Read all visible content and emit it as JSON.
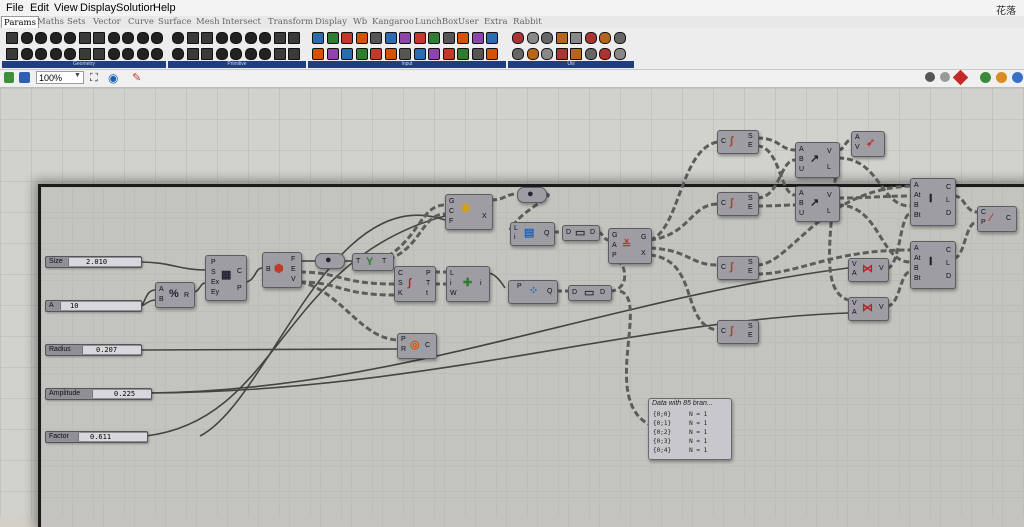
{
  "menu": [
    "File",
    "Edit",
    "View",
    "Display",
    "Solution",
    "Help"
  ],
  "app_corner": "花落",
  "tabs": [
    "Params",
    "Maths",
    "Sets",
    "Vector",
    "Curve",
    "Surface",
    "Mesh",
    "Intersect",
    "Transform",
    "Display",
    "Wb",
    "Kangaroo",
    "LunchBox",
    "User",
    "Extra",
    "Rabbit"
  ],
  "ribbon_panels": [
    "Geometry",
    "Primitive",
    "Input",
    "Util"
  ],
  "zoom": "100%",
  "sliders": {
    "size": {
      "label": "Size",
      "value": "2.010"
    },
    "a": {
      "label": "A",
      "value": "10"
    },
    "radius": {
      "label": "Radius",
      "value": "0.207"
    },
    "amplitude": {
      "label": "Amplitude",
      "value": "0.225"
    },
    "factor": {
      "label": "Factor",
      "value": "0.611"
    }
  },
  "panel": {
    "header": "Data with 85 bran...",
    "rows": [
      {
        "path": "{0;0}",
        "val": "N = 1"
      },
      {
        "path": "{0;1}",
        "val": "N = 1"
      },
      {
        "path": "{0;2}",
        "val": "N = 1"
      },
      {
        "path": "{0;3}",
        "val": "N = 1"
      },
      {
        "path": "{0;4}",
        "val": "N = 1"
      }
    ]
  },
  "ports": {
    "cplane": {
      "in": [
        "P",
        "S",
        "Ex",
        "Ey"
      ],
      "out": [
        "C",
        "P"
      ]
    },
    "box": {
      "in": [
        "B"
      ],
      "out": [
        "F",
        "E",
        "V"
      ]
    },
    "text": {
      "in": [
        "T"
      ],
      "out": [
        "T"
      ]
    },
    "curve1": {
      "in": [
        "C",
        "S",
        "K"
      ],
      "out": [
        "P",
        "T",
        "t"
      ]
    },
    "line": {
      "in": [
        "L",
        "i",
        "W"
      ],
      "out": [
        "i"
      ]
    },
    "list1": {
      "in": [
        "L",
        "i"
      ],
      "out": [
        "Q"
      ]
    },
    "dd1": {
      "in": [
        "D"
      ],
      "out": [
        "D"
      ]
    },
    "dd2": {
      "in": [
        "D"
      ],
      "out": [
        "D"
      ]
    },
    "pt2": {
      "in": [
        "P"
      ],
      "out": [
        "Q"
      ]
    },
    "circle": {
      "in": [
        "P",
        "R"
      ],
      "out": [
        "C"
      ]
    },
    "eval": {
      "in": [
        "G",
        "A",
        "P"
      ],
      "out": [
        "G",
        "X"
      ]
    },
    "crv": {
      "in": [
        "G",
        "C",
        "F"
      ],
      "out": [
        "X"
      ]
    },
    "ab": {
      "in": [
        "A",
        "B"
      ],
      "out": [
        "R"
      ]
    },
    "seg": {
      "in": [
        "C"
      ],
      "out": [
        "S",
        "E"
      ]
    },
    "vec": {
      "in": [
        "A",
        "B",
        "U"
      ],
      "out": [
        "V",
        "L"
      ]
    },
    "av": {
      "in": [
        "A",
        "V"
      ],
      "out": []
    },
    "arc": {
      "in": [
        "A",
        "At",
        "B",
        "Bt"
      ],
      "out": [
        "C",
        "L",
        "D"
      ]
    },
    "va": {
      "in": [
        "V",
        "A"
      ],
      "out": [
        "V"
      ]
    },
    "cp": {
      "in": [
        "C",
        "P"
      ],
      "out": [
        "C"
      ]
    }
  }
}
